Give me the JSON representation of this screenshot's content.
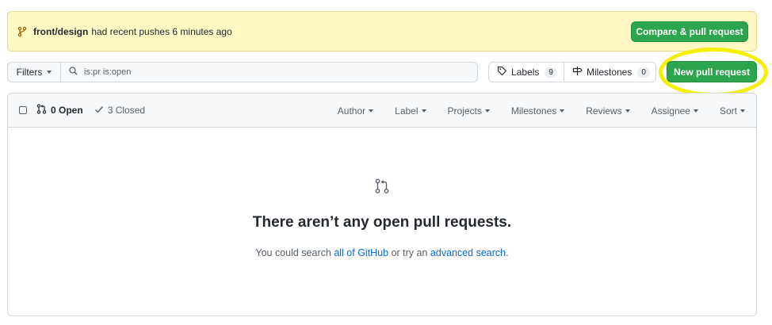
{
  "banner": {
    "branch": "front/design",
    "text": "had recent pushes 6 minutes ago",
    "compare_button": "Compare & pull request"
  },
  "toolbar": {
    "filters_label": "Filters",
    "search_value": "is:pr is:open",
    "labels_label": "Labels",
    "labels_count": "9",
    "milestones_label": "Milestones",
    "milestones_count": "0",
    "new_pr_label": "New pull request"
  },
  "list_header": {
    "open_label": "0 Open",
    "closed_label": "3 Closed",
    "filters": [
      "Author",
      "Label",
      "Projects",
      "Milestones",
      "Reviews",
      "Assignee",
      "Sort"
    ]
  },
  "blankslate": {
    "title": "There aren’t any open pull requests.",
    "desc_prefix": "You could search",
    "link_all": "all of GitHub",
    "desc_middle": "or try an",
    "link_advanced": "advanced search",
    "desc_suffix": "."
  },
  "colors": {
    "primary_button": "#2da44e",
    "banner_bg": "#fff8c5",
    "highlight": "#f5f000",
    "link": "#0969da"
  }
}
